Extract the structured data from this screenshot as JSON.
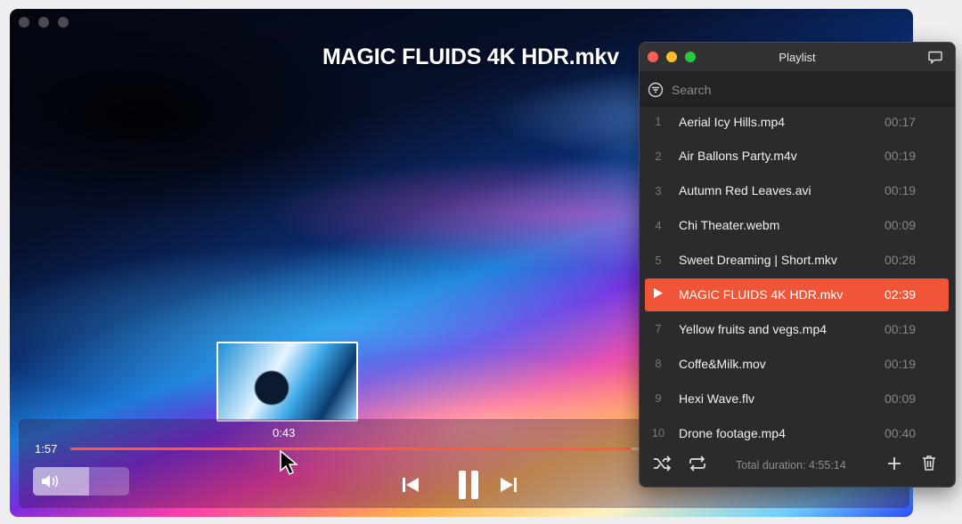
{
  "player": {
    "title": "MAGIC FLUIDS 4K HDR.mkv",
    "current_time": "1:57",
    "hover_time": "0:43",
    "progress_fraction": 0.7,
    "volume_fraction": 0.58
  },
  "playlist": {
    "title": "Playlist",
    "search_placeholder": "Search",
    "items": [
      {
        "num": "1",
        "name": "Aerial Icy Hills.mp4",
        "duration": "00:17",
        "active": false
      },
      {
        "num": "2",
        "name": "Air Ballons Party.m4v",
        "duration": "00:19",
        "active": false
      },
      {
        "num": "3",
        "name": "Autumn Red Leaves.avi",
        "duration": "00:19",
        "active": false
      },
      {
        "num": "4",
        "name": "Chi Theater.webm",
        "duration": "00:09",
        "active": false
      },
      {
        "num": "5",
        "name": "Sweet Dreaming | Short.mkv",
        "duration": "00:28",
        "active": false
      },
      {
        "num": "",
        "name": "MAGIC FLUIDS 4K HDR.mkv",
        "duration": "02:39",
        "active": true
      },
      {
        "num": "7",
        "name": "Yellow fruits and vegs.mp4",
        "duration": "00:19",
        "active": false
      },
      {
        "num": "8",
        "name": "Coffe&Milk.mov",
        "duration": "00:19",
        "active": false
      },
      {
        "num": "9",
        "name": "Hexi Wave.flv",
        "duration": "00:09",
        "active": false
      },
      {
        "num": "10",
        "name": "Drone footage.mp4",
        "duration": "00:40",
        "active": false
      }
    ],
    "total_duration": "Total duration: 4:55:14"
  },
  "colors": {
    "accent": "#f05537",
    "close": "#ff5f57",
    "minimize": "#febc2e",
    "zoom": "#28c840"
  },
  "icons": [
    "shuffle-icon",
    "repeat-icon",
    "add-icon",
    "trash-icon",
    "previous-icon",
    "pause-icon",
    "next-icon",
    "volume-icon",
    "search-filter-icon",
    "chat-icon",
    "play-indicator-icon"
  ]
}
